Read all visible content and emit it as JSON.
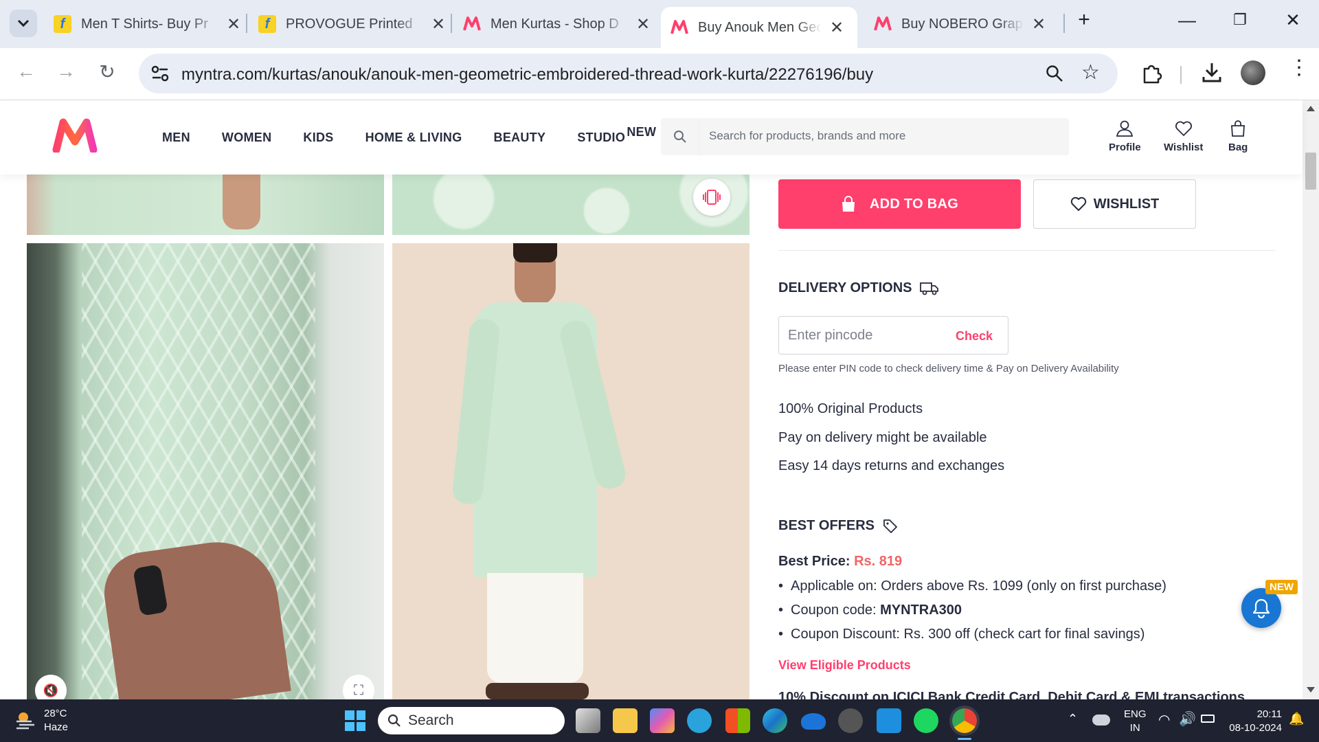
{
  "browser": {
    "tabs": [
      {
        "title": "Men T Shirts- Buy Pr",
        "favicon": "flipkart",
        "active": false
      },
      {
        "title": "PROVOGUE Printed",
        "favicon": "flipkart",
        "active": false
      },
      {
        "title": "Men Kurtas - Shop D",
        "favicon": "myntra",
        "active": false
      },
      {
        "title": "Buy Anouk Men Geo",
        "favicon": "myntra",
        "active": true
      },
      {
        "title": "Buy NOBERO Graph",
        "favicon": "myntra",
        "active": false
      }
    ],
    "url": "myntra.com/kurtas/anouk/anouk-men-geometric-embroidered-thread-work-kurta/22276196/buy"
  },
  "header": {
    "nav": [
      "MEN",
      "WOMEN",
      "KIDS",
      "HOME & LIVING",
      "BEAUTY",
      "STUDIO"
    ],
    "studio_badge": "NEW",
    "search_placeholder": "Search for products, brands and more",
    "profile": "Profile",
    "wishlist": "Wishlist",
    "bag": "Bag"
  },
  "product": {
    "add_to_bag": "ADD TO BAG",
    "wishlist_btn": "WISHLIST",
    "delivery_title": "DELIVERY OPTIONS",
    "pincode_placeholder": "Enter pincode",
    "check": "Check",
    "pin_note": "Please enter PIN code to check delivery time & Pay on Delivery Availability",
    "assurances": [
      "100% Original Products",
      "Pay on delivery might be available",
      "Easy 14 days returns and exchanges"
    ],
    "offers_title": "BEST OFFERS",
    "best_price_label": "Best Price:",
    "best_price_value": "Rs. 819",
    "offer_lines": [
      {
        "text": "Applicable on: Orders above Rs. 1099 (only on first purchase)",
        "bold": ""
      },
      {
        "text": "Coupon code: ",
        "bold": "MYNTRA300"
      },
      {
        "text": "Coupon Discount: Rs. 300 off (check cart for final savings)",
        "bold": ""
      }
    ],
    "view_eligible": "View Eligible Products",
    "next_offer": "10% Discount on ICICI Bank Credit Card, Debit Card & EMI transactions"
  },
  "notif_badge": "NEW",
  "taskbar": {
    "weather_temp": "28°C",
    "weather_desc": "Haze",
    "search": "Search",
    "lang_top": "ENG",
    "lang_bottom": "IN",
    "time": "20:11",
    "date": "08-10-2024"
  },
  "colors": {
    "brand": "#ff3f6c",
    "price": "#f16565",
    "kurta": "#cfe8d4"
  }
}
